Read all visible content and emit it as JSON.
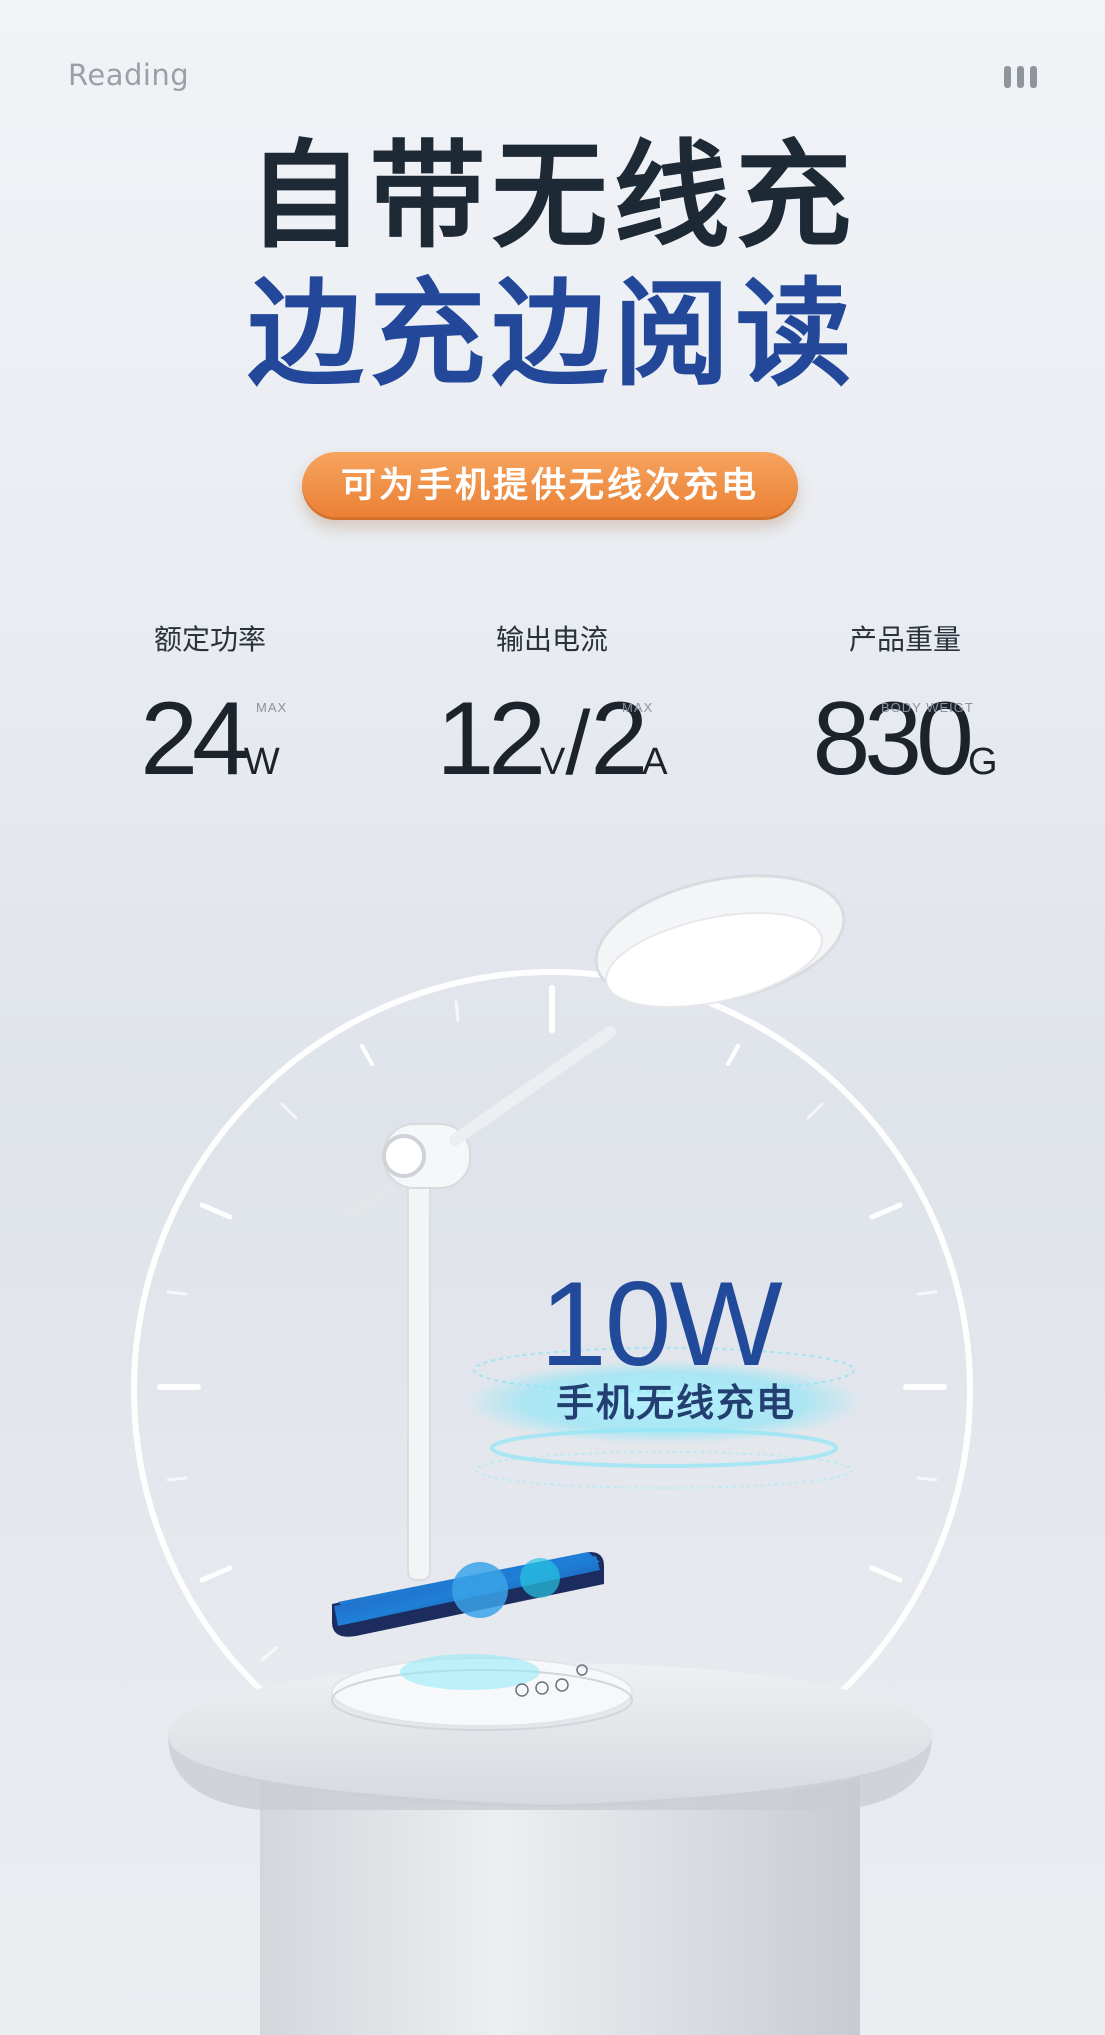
{
  "header": {
    "brand": "Reading"
  },
  "headline": {
    "line1": "自带无线充",
    "line2": "边充边阅读"
  },
  "badge": {
    "text": "可为手机提供无线次充电"
  },
  "stats": [
    {
      "label": "额定功率",
      "value": "24",
      "unit": "W",
      "qualifier": "MAX"
    },
    {
      "label": "输出电流",
      "value_a": "12",
      "unit_a": "V",
      "sep": "/",
      "value_b": "2",
      "unit_b": "A",
      "qualifier": "MAX"
    },
    {
      "label": "产品重量",
      "value": "830",
      "unit": "G",
      "qualifier": "BODY WEIGT"
    }
  ],
  "feature": {
    "value": "10W",
    "caption": "手机无线充电"
  },
  "colors": {
    "headline_dark": "#1d2a36",
    "headline_blue": "#23489a",
    "badge_orange": "#ef8b3f",
    "feature_blue": "#214a9a"
  },
  "icons": [
    "menu-icon",
    "desk-lamp-illustration",
    "smartphone-illustration",
    "wireless-charge-rings",
    "pedestal-illustration"
  ]
}
